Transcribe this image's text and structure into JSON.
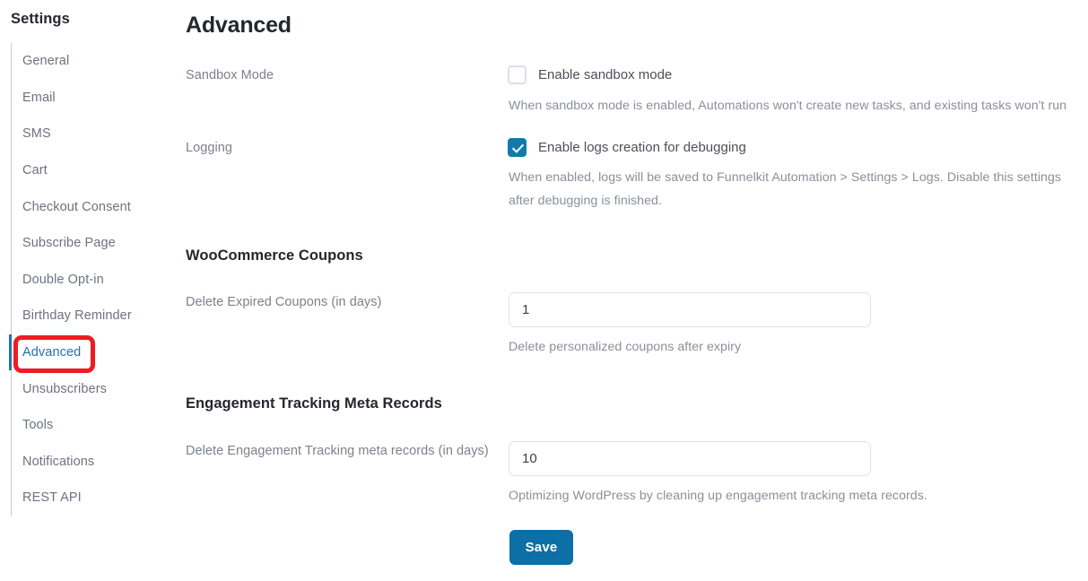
{
  "sidebar": {
    "title": "Settings",
    "items": [
      {
        "label": "General",
        "active": false
      },
      {
        "label": "Email",
        "active": false
      },
      {
        "label": "SMS",
        "active": false
      },
      {
        "label": "Cart",
        "active": false
      },
      {
        "label": "Checkout Consent",
        "active": false
      },
      {
        "label": "Subscribe Page",
        "active": false
      },
      {
        "label": "Double Opt-in",
        "active": false
      },
      {
        "label": "Birthday Reminder",
        "active": false
      },
      {
        "label": "Advanced",
        "active": true
      },
      {
        "label": "Unsubscribers",
        "active": false
      },
      {
        "label": "Tools",
        "active": false
      },
      {
        "label": "Notifications",
        "active": false
      },
      {
        "label": "REST API",
        "active": false
      }
    ]
  },
  "main": {
    "page_title": "Advanced",
    "sandbox": {
      "label": "Sandbox Mode",
      "checkbox_label": "Enable sandbox mode",
      "checked": false,
      "helper": "When sandbox mode is enabled, Automations won't create new tasks, and existing tasks won't run"
    },
    "logging": {
      "label": "Logging",
      "checkbox_label": "Enable logs creation for debugging",
      "checked": true,
      "helper": "When enabled, logs will be saved to Funnelkit Automation > Settings > Logs. Disable this settings after debugging is finished."
    },
    "coupons": {
      "heading": "WooCommerce Coupons",
      "label": "Delete Expired Coupons (in days)",
      "value": "1",
      "helper": "Delete personalized coupons after expiry"
    },
    "engagement": {
      "heading": "Engagement Tracking Meta Records",
      "label": "Delete Engagement Tracking meta records (in days)",
      "value": "10",
      "helper": "Optimizing WordPress by cleaning up engagement tracking meta records."
    },
    "save_label": "Save"
  },
  "annotation": {
    "color": "#ee1c22",
    "target": "Advanced"
  },
  "colors": {
    "accent": "#2271b1",
    "checkbox_checked": "#1279ad",
    "save_button": "#0c6fa5",
    "annotation_red": "#ee1c22"
  }
}
